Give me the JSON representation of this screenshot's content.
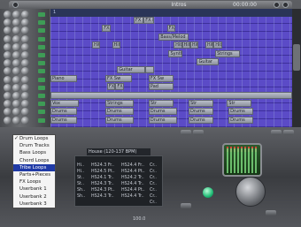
{
  "window": {
    "title": "Intros",
    "time": "00:00:00"
  },
  "ruler": {
    "labels": [
      "1",
      "",
      "",
      "",
      "",
      "",
      "",
      ""
    ]
  },
  "arrange": {
    "blocks": [
      {
        "lane": 0,
        "start": 10.0,
        "len": 1.2,
        "label": "FX Fill"
      },
      {
        "lane": 0,
        "start": 11.2,
        "len": 1.2,
        "label": "FX Fill"
      },
      {
        "lane": 1,
        "start": 6.2,
        "len": 1.0,
        "label": "FX Fill"
      },
      {
        "lane": 1,
        "start": 14.0,
        "len": 1.0,
        "label": "FX Fill"
      },
      {
        "lane": 2,
        "start": 13.0,
        "len": 3.6,
        "label": "Bass/Melod"
      },
      {
        "lane": 3,
        "start": 5.0,
        "len": 1.0,
        "label": "Hit"
      },
      {
        "lane": 3,
        "start": 7.4,
        "len": 1.0,
        "label": "Hit"
      },
      {
        "lane": 3,
        "start": 14.8,
        "len": 1.0,
        "label": "Hit"
      },
      {
        "lane": 3,
        "start": 15.8,
        "len": 1.0,
        "label": "Hit"
      },
      {
        "lane": 3,
        "start": 16.8,
        "len": 1.0,
        "label": "Hit"
      },
      {
        "lane": 3,
        "start": 18.6,
        "len": 1.0,
        "label": "Hit"
      },
      {
        "lane": 3,
        "start": 19.6,
        "len": 1.0,
        "label": "Hit"
      },
      {
        "lane": 4,
        "start": 14.2,
        "len": 1.6,
        "label": "Synth"
      },
      {
        "lane": 4,
        "start": 19.8,
        "len": 3.0,
        "label": "Strings"
      },
      {
        "lane": 5,
        "start": 17.6,
        "len": 2.6,
        "label": "Guitar"
      },
      {
        "lane": 6,
        "start": 8.0,
        "len": 3.4,
        "label": "Guitar"
      },
      {
        "lane": 6,
        "start": 11.4,
        "len": 1.0,
        "label": ""
      },
      {
        "lane": 7,
        "start": 0.0,
        "len": 3.2,
        "label": "Piano"
      },
      {
        "lane": 7,
        "start": 6.6,
        "len": 3.2,
        "label": "FX Sw"
      },
      {
        "lane": 7,
        "start": 11.8,
        "len": 3.0,
        "label": "FX Sw"
      },
      {
        "lane": 8,
        "start": 6.8,
        "len": 1.0,
        "label": "FX"
      },
      {
        "lane": 8,
        "start": 7.8,
        "len": 1.0,
        "label": "FX"
      },
      {
        "lane": 8,
        "start": 11.8,
        "len": 3.0,
        "label": "Pad"
      },
      {
        "lane": 9,
        "start": 0.0,
        "len": 29.0,
        "label": ""
      },
      {
        "lane": 10,
        "start": 0.0,
        "len": 3.4,
        "label": "Vox"
      },
      {
        "lane": 10,
        "start": 6.6,
        "len": 3.4,
        "label": "Strings"
      },
      {
        "lane": 10,
        "start": 11.8,
        "len": 3.0,
        "label": "Str"
      },
      {
        "lane": 10,
        "start": 16.6,
        "len": 3.0,
        "label": "Str"
      },
      {
        "lane": 10,
        "start": 21.2,
        "len": 3.0,
        "label": "Str"
      },
      {
        "lane": 11,
        "start": 0.0,
        "len": 3.2,
        "label": "Drums"
      },
      {
        "lane": 11,
        "start": 6.6,
        "len": 3.4,
        "label": "Drums"
      },
      {
        "lane": 11,
        "start": 11.8,
        "len": 3.4,
        "label": "Drums"
      },
      {
        "lane": 11,
        "start": 16.6,
        "len": 3.0,
        "label": "Drums"
      },
      {
        "lane": 11,
        "start": 21.4,
        "len": 3.0,
        "label": "Drums"
      },
      {
        "lane": 12,
        "start": 0.0,
        "len": 3.2,
        "label": "Drums"
      },
      {
        "lane": 12,
        "start": 6.6,
        "len": 3.4,
        "label": "Drums"
      },
      {
        "lane": 12,
        "start": 11.8,
        "len": 3.4,
        "label": "Drums"
      },
      {
        "lane": 12,
        "start": 16.6,
        "len": 3.0,
        "label": "Drums"
      },
      {
        "lane": 12,
        "start": 21.4,
        "len": 3.0,
        "label": "Drums"
      }
    ]
  },
  "menu": {
    "items": [
      {
        "label": "Drum Loops",
        "checked": true,
        "selected": false
      },
      {
        "label": "Drum Tracks",
        "checked": false,
        "selected": false
      },
      {
        "label": "Bass Loops",
        "checked": false,
        "selected": false
      },
      {
        "label": "Chord Loops",
        "checked": false,
        "selected": false
      },
      {
        "label": "Tribe Loops",
        "checked": false,
        "selected": true
      },
      {
        "label": "Parts+Pieces",
        "checked": false,
        "selected": false
      },
      {
        "label": "FX Loops",
        "checked": false,
        "selected": false
      },
      {
        "label": "Userbank 1",
        "checked": false,
        "selected": false
      },
      {
        "label": "Userbank 2",
        "checked": false,
        "selected": false
      },
      {
        "label": "Userbank 3",
        "checked": false,
        "selected": false
      }
    ]
  },
  "loops": {
    "header": "House (120-137 BPM)",
    "rows": [
      [
        "",
        "",
        "",
        ""
      ],
      [
        "Hi..",
        "HS24.3 Fr..",
        "HS24.4 Fr..",
        "Cr.."
      ],
      [
        "Hi..",
        "HS24.5 Pt..",
        "HS24.4 Pt..",
        "Cr.."
      ],
      [
        "St..",
        "HS24.1 Tr..",
        "HS24.2 Tr..",
        "Cr.."
      ],
      [
        "St..",
        "HS24.3 Tr..",
        "HS24.4 Tr..",
        "Cr.."
      ],
      [
        "Sh..",
        "HS24.3 Pt..",
        "HS24.4 Pt..",
        "Cr.."
      ],
      [
        "Sh..",
        "HS24.3 Tr..",
        "HS24.4 Tr..",
        "Cr.."
      ],
      [
        "",
        "",
        "",
        "Cr.."
      ]
    ]
  },
  "status": {
    "tempo": "100.0"
  }
}
